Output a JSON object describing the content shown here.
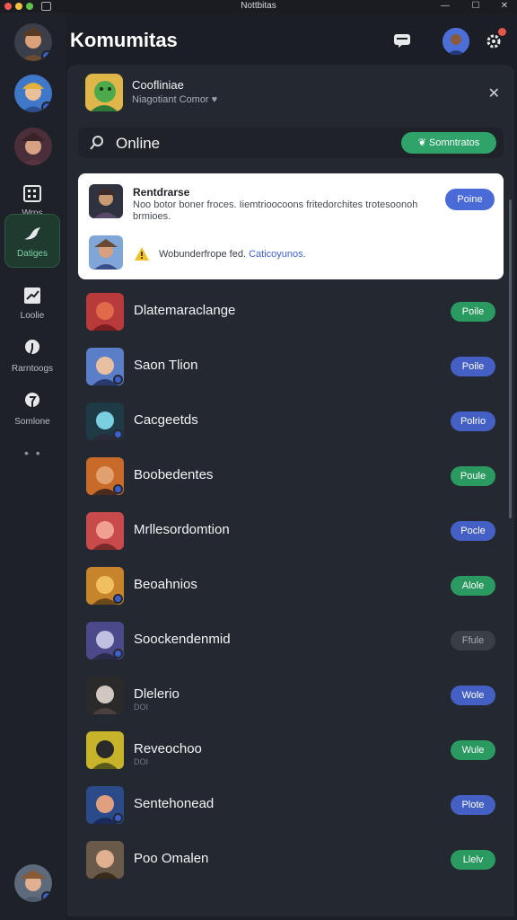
{
  "window": {
    "title": "Nottbitas"
  },
  "sidebar": {
    "items": [
      {
        "label": "Wrns",
        "icon": "calendar-icon",
        "active": false
      },
      {
        "label": "Datiges",
        "icon": "bird-icon",
        "active": true
      },
      {
        "label": "Loolie",
        "icon": "chart-icon",
        "active": false
      },
      {
        "label": "Rarntoogs",
        "icon": "pin-icon",
        "active": false
      },
      {
        "label": "Somlone",
        "icon": "marker-icon",
        "active": false
      }
    ],
    "more": "• •"
  },
  "header": {
    "title": "Komumitas"
  },
  "group": {
    "name": "Coofliniae",
    "subtitle": "Niagotiant Comor",
    "heart": "♥"
  },
  "search": {
    "text": "Online",
    "button_label": "Somntratos"
  },
  "notification": {
    "title": "Rentdrarse",
    "text": "Noo botor boner froces. Iiemtrioocoons fritedorchites trotesoonoh brmioes.",
    "button_label": "Poine",
    "line2_text": "Wobunderfrope fed.",
    "line2_link": "Caticoyunos."
  },
  "members": [
    {
      "name": "Dlatemaraclange",
      "sub": "",
      "status": "Poile",
      "color": "green"
    },
    {
      "name": "Saon Tlion",
      "sub": "",
      "status": "Poile",
      "color": "blue"
    },
    {
      "name": "Cacgeetds",
      "sub": "",
      "status": "Polrio",
      "color": "blue"
    },
    {
      "name": "Boobedentes",
      "sub": "",
      "status": "Poule",
      "color": "green"
    },
    {
      "name": "Mrllesordomtion",
      "sub": "",
      "status": "Pocle",
      "color": "blue"
    },
    {
      "name": "Beoahnios",
      "sub": "",
      "status": "Alole",
      "color": "green"
    },
    {
      "name": "Soockendenmid",
      "sub": "",
      "status": "Ffule",
      "color": "gray"
    },
    {
      "name": "Dlelerio",
      "sub": "DOI",
      "status": "Wole",
      "color": "blue"
    },
    {
      "name": "Reveochoo",
      "sub": "DOI",
      "status": "Wule",
      "color": "green"
    },
    {
      "name": "Sentehonead",
      "sub": "",
      "status": "Plote",
      "color": "blue"
    },
    {
      "name": "Poo Omalen",
      "sub": "",
      "status": "Llelv",
      "color": "green"
    }
  ],
  "colors": {
    "green": "#2a9a60",
    "blue": "#4560c4",
    "panel": "#242830",
    "bg": "#1b1e24"
  }
}
